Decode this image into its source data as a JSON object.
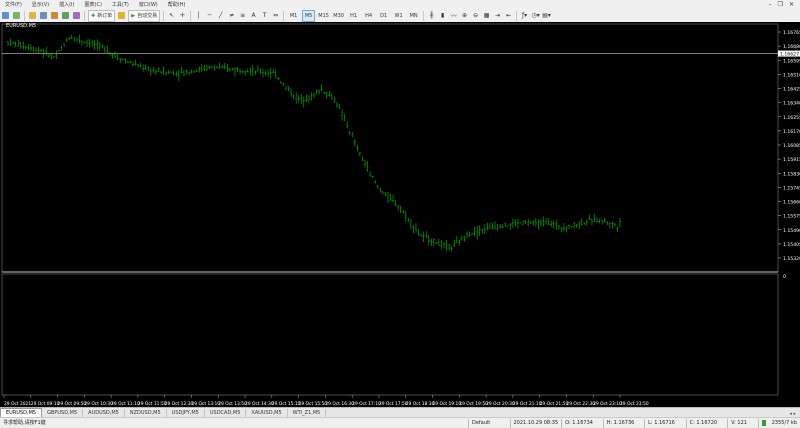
{
  "menu": {
    "items": [
      "文件(F)",
      "显示(V)",
      "插入(I)",
      "图表(C)",
      "工具(T)",
      "窗口(W)",
      "帮助(H)"
    ]
  },
  "toolbar": {
    "new_order": "新订单",
    "auto_trade": "自动交易",
    "timeframes": [
      "M1",
      "M5",
      "M15",
      "M30",
      "H1",
      "H4",
      "D1",
      "W1",
      "MN"
    ],
    "active_timeframe": "M5"
  },
  "chart": {
    "symbol_label": "EURUSD,M5",
    "bid_line_value": "1.16627",
    "price_labels": [
      "1.16765",
      "1.16680",
      "1.16595",
      "1.16510",
      "1.16425",
      "1.16340",
      "1.16255",
      "1.16170",
      "1.16085",
      "1.15915",
      "1.15830",
      "1.15745",
      "1.15660",
      "1.15575",
      "1.15490",
      "1.15405",
      "1.15320"
    ],
    "sub_window_label": "0",
    "time_labels": [
      "29 Oct 2021",
      "29 Oct 09:10",
      "29 Oct 09:50",
      "29 Oct 10:30",
      "29 Oct 11:10",
      "29 Oct 11:50",
      "29 Oct 12:30",
      "29 Oct 13:10",
      "29 Oct 13:50",
      "29 Oct 14:30",
      "29 Oct 15:10",
      "29 Oct 15:50",
      "29 Oct 16:30",
      "29 Oct 17:10",
      "29 Oct 17:50",
      "29 Oct 18:30",
      "29 Oct 19:10",
      "29 Oct 19:50",
      "29 Oct 20:30",
      "29 Oct 21:10",
      "29 Oct 21:50",
      "29 Oct 22:30",
      "29 Oct 23:10",
      "29 Oct 23:50"
    ],
    "colors": {
      "background": "#000000",
      "bars": "#00c000",
      "grid_line": "#c8c8c8",
      "text": "#ffffff"
    }
  },
  "tabs": [
    "EURUSD,M5",
    "GBPUSD,M5",
    "AUDUSD,M5",
    "NZDUSD,M5",
    "USDJPY,M5",
    "USDCAD,M5",
    "XAUUSD,M5",
    "WTI_Z1,M5"
  ],
  "active_tab": "EURUSD,M5",
  "status": {
    "help": "寻求帮助,请按F1键",
    "profile": "Default",
    "datetime": "2021.10.29 08:35",
    "open": "O: 1.16734",
    "high": "H: 1.16736",
    "low": "L: 1.16716",
    "close": "C: 1.16720",
    "volume": "V: 121",
    "traffic": "2355/7 kb"
  }
}
